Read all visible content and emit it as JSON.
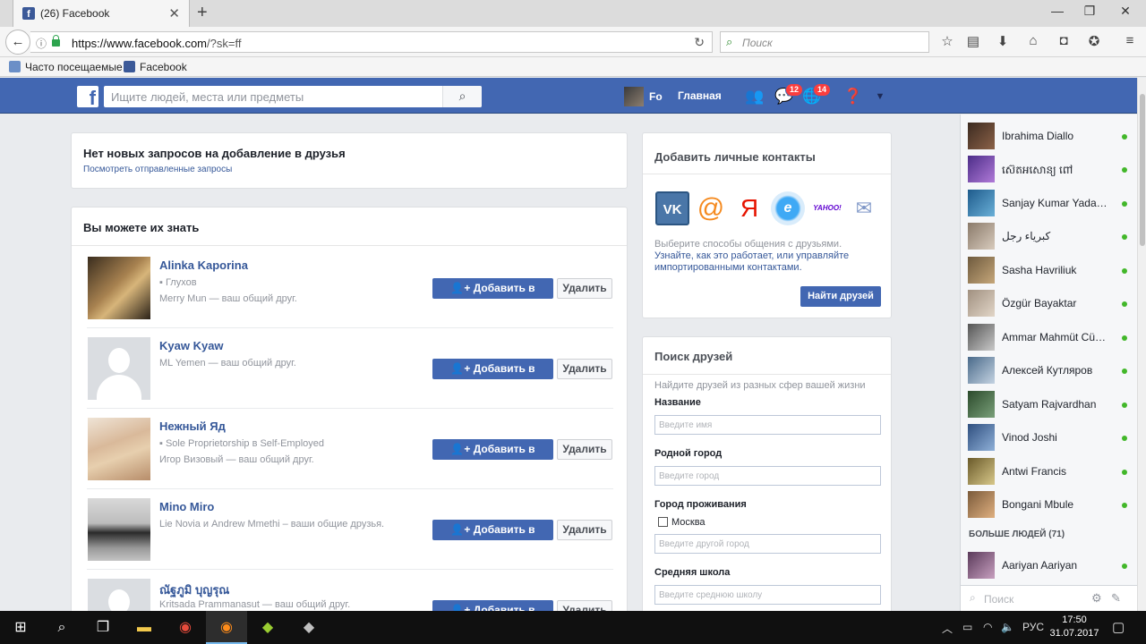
{
  "browser": {
    "tab_title": "(26) Facebook",
    "tab_close": "✕",
    "new_tab": "+",
    "url_domain": "https://www.facebook.com",
    "url_rest": "/?sk=ff",
    "search_placeholder": "Поиск",
    "bookmarks": [
      "Часто посещаемые",
      "Facebook"
    ]
  },
  "fb": {
    "search_placeholder": "Ищите людей, места или предметы",
    "user_name": "Fo",
    "home_label": "Главная",
    "messages_count": "12",
    "notifications_count": "14",
    "brand_color": "#4267b2"
  },
  "requests": {
    "title": "Нет новых запросов на добавление в друзья",
    "link": "Посмотреть отправленные запросы"
  },
  "pymk": {
    "title": "Вы можете их знать",
    "add_label": "Добавить в друзья",
    "remove_label": "Удалить",
    "people": [
      {
        "name": "Alinka Kaporina",
        "line1": "Глухов",
        "line2": "Merry Mun — ваш общий друг."
      },
      {
        "name": "Kyaw Kyaw",
        "line1": "ML Yemen — ваш общий друг.",
        "line2": ""
      },
      {
        "name": "Нежный Яд",
        "line1": "Sole Proprietorship в Self-Employed",
        "line2": "Игор Визовый — ваш общий друг."
      },
      {
        "name": "Mino Miro",
        "line1": "Lie Novia и Andrew Mmethi – ваши общие друзья.",
        "line2": ""
      },
      {
        "name": "ณัฐภูมิ บุญรุณ",
        "line1": "Kritsada Prammanasut — ваш общий друг.",
        "line2": ""
      }
    ]
  },
  "contacts": {
    "title": "Добавить личные контакты",
    "services": [
      "VK",
      "@",
      "Я",
      "e",
      "YAHOO!",
      "✉"
    ],
    "desc_plain": "Выберите способы общения с друзьями.",
    "desc_link": "Узнайте, как это работает, или управляйте импортированными контактами.",
    "find_button": "Найти друзей"
  },
  "friend_search": {
    "title": "Поиск друзей",
    "subtitle": "Найдите друзей из разных сфер вашей жизни",
    "name_label": "Название",
    "name_placeholder": "Введите имя",
    "hometown_label": "Родной город",
    "hometown_placeholder": "Введите город",
    "current_city_label": "Город проживания",
    "current_city_option": "Москва",
    "current_city_placeholder": "Введите другой город",
    "school_label": "Средняя школа",
    "school_placeholder": "Введите среднюю школу"
  },
  "chat": {
    "contacts": [
      "Ibrahima Diallo",
      "ស៊េតអសោន្យ ពៅ",
      "Sanjay Kumar Yadav ...",
      "كبرياء رجل",
      "Sasha Havriliuk",
      "Özgür Bayaktar",
      "Ammar Mahmüt Cünedi",
      "Алексей Кутляров",
      "Satyam Rajvardhan",
      "Vinod Joshi",
      "Antwi Francis",
      "Bongani Mbule"
    ],
    "more_label": "БОЛЬШЕ ЛЮДЕЙ (71)",
    "extra_contact": "Aariyan Aariyan",
    "search_placeholder": "Поиск"
  },
  "taskbar": {
    "lang": "РУС",
    "time": "17:50",
    "date": "31.07.2017"
  }
}
